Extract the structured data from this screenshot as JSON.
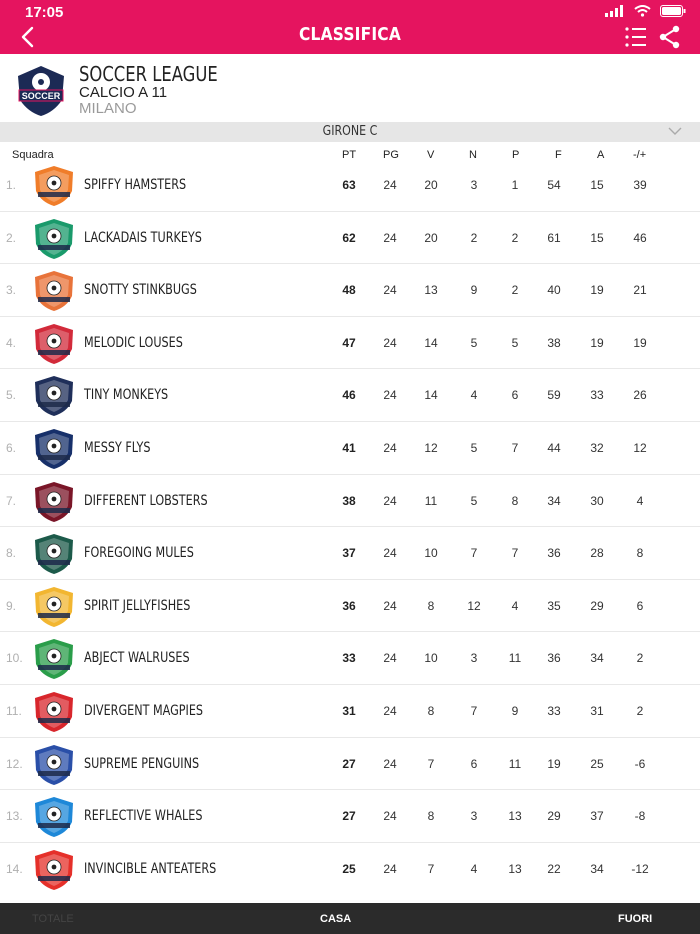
{
  "status": {
    "time": "17:05"
  },
  "nav": {
    "title": "CLASSIFICA"
  },
  "league": {
    "name": "SOCCER LEAGUE",
    "subtitle": "CALCIO A 11",
    "city": "MILANO",
    "logo_text": "SOCCER"
  },
  "group": {
    "label": "GIRONE C"
  },
  "columns": {
    "team": "Squadra",
    "pt": "PT",
    "pg": "PG",
    "v": "V",
    "n": "N",
    "p": "P",
    "f": "F",
    "a": "A",
    "diff": "-/+"
  },
  "standings": [
    {
      "rank": "1.",
      "team": "SPIFFY HAMSTERS",
      "pt": "63",
      "pg": "24",
      "v": "20",
      "n": "3",
      "p": "1",
      "f": "54",
      "a": "15",
      "diff": "39",
      "crest_color": "#f07d2a"
    },
    {
      "rank": "2.",
      "team": "LACKADAIS TURKEYS",
      "pt": "62",
      "pg": "24",
      "v": "20",
      "n": "2",
      "p": "2",
      "f": "61",
      "a": "15",
      "diff": "46",
      "crest_color": "#1a9a6b"
    },
    {
      "rank": "3.",
      "team": "SNOTTY STINKBUGS",
      "pt": "48",
      "pg": "24",
      "v": "13",
      "n": "9",
      "p": "2",
      "f": "40",
      "a": "19",
      "diff": "21",
      "crest_color": "#e8733a"
    },
    {
      "rank": "4.",
      "team": "MELODIC LOUSES",
      "pt": "47",
      "pg": "24",
      "v": "14",
      "n": "5",
      "p": "5",
      "f": "38",
      "a": "19",
      "diff": "19",
      "crest_color": "#d22a3a"
    },
    {
      "rank": "5.",
      "team": "TINY MONKEYS",
      "pt": "46",
      "pg": "24",
      "v": "14",
      "n": "4",
      "p": "6",
      "f": "59",
      "a": "33",
      "diff": "26",
      "crest_color": "#1f2f5a"
    },
    {
      "rank": "6.",
      "team": "MESSY FLYS",
      "pt": "41",
      "pg": "24",
      "v": "12",
      "n": "5",
      "p": "7",
      "f": "44",
      "a": "32",
      "diff": "12",
      "crest_color": "#17306a"
    },
    {
      "rank": "7.",
      "team": "DIFFERENT LOBSTERS",
      "pt": "38",
      "pg": "24",
      "v": "11",
      "n": "5",
      "p": "8",
      "f": "34",
      "a": "30",
      "diff": "4",
      "crest_color": "#7a1628"
    },
    {
      "rank": "8.",
      "team": "FOREGOING MULES",
      "pt": "37",
      "pg": "24",
      "v": "10",
      "n": "7",
      "p": "7",
      "f": "36",
      "a": "28",
      "diff": "8",
      "crest_color": "#1c5a4a"
    },
    {
      "rank": "9.",
      "team": "SPIRIT JELLYFISHES",
      "pt": "36",
      "pg": "24",
      "v": "8",
      "n": "12",
      "p": "4",
      "f": "35",
      "a": "29",
      "diff": "6",
      "crest_color": "#f2b631"
    },
    {
      "rank": "10.",
      "team": "ABJECT WALRUSES",
      "pt": "33",
      "pg": "24",
      "v": "10",
      "n": "3",
      "p": "11",
      "f": "36",
      "a": "34",
      "diff": "2",
      "crest_color": "#2a9d4a"
    },
    {
      "rank": "11.",
      "team": "DIVERGENT MAGPIES",
      "pt": "31",
      "pg": "24",
      "v": "8",
      "n": "7",
      "p": "9",
      "f": "33",
      "a": "31",
      "diff": "2",
      "crest_color": "#d8262c"
    },
    {
      "rank": "12.",
      "team": "SUPREME PENGUINS",
      "pt": "27",
      "pg": "24",
      "v": "7",
      "n": "6",
      "p": "11",
      "f": "19",
      "a": "25",
      "diff": "-6",
      "crest_color": "#2a4fa8"
    },
    {
      "rank": "13.",
      "team": "REFLECTIVE WHALES",
      "pt": "27",
      "pg": "24",
      "v": "8",
      "n": "3",
      "p": "13",
      "f": "29",
      "a": "37",
      "diff": "-8",
      "crest_color": "#1e88d8"
    },
    {
      "rank": "14.",
      "team": "INVINCIBLE ANTEATERS",
      "pt": "25",
      "pg": "24",
      "v": "7",
      "n": "4",
      "p": "13",
      "f": "22",
      "a": "34",
      "diff": "-12",
      "crest_color": "#e5302a"
    }
  ],
  "tabs": {
    "total": "TOTALE",
    "home": "CASA",
    "away": "FUORI"
  },
  "colors": {
    "brand": "#e5145f",
    "bottom_bar": "#2b2b2b"
  }
}
